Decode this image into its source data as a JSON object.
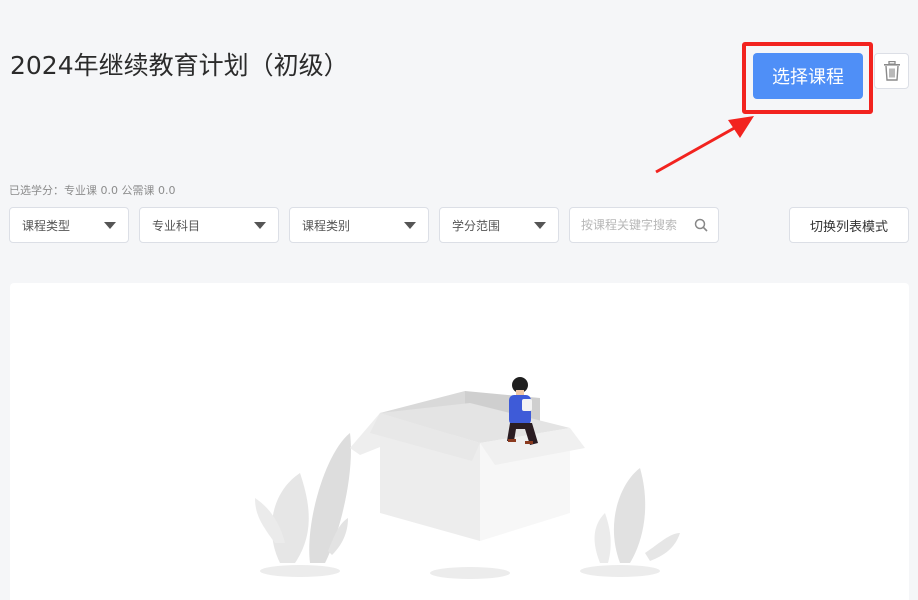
{
  "header": {
    "title": "2024年继续教育计划（初级）",
    "select_course_label": "选择课程"
  },
  "summary": {
    "text": "已选学分：专业课 0.0 公需课 0.0"
  },
  "filters": [
    {
      "label": "课程类型"
    },
    {
      "label": "专业科目"
    },
    {
      "label": "课程类别"
    },
    {
      "label": "学分范围"
    }
  ],
  "search": {
    "placeholder": "按课程关键字搜索",
    "value": ""
  },
  "list_mode_label": "切换列表模式",
  "icons": {
    "trash": "trash-icon",
    "search": "search-icon",
    "dropdown": "caret-down-icon"
  },
  "colors": {
    "primary": "#4f8ff7",
    "highlight": "#f2231f",
    "background": "#f5f6f8"
  }
}
